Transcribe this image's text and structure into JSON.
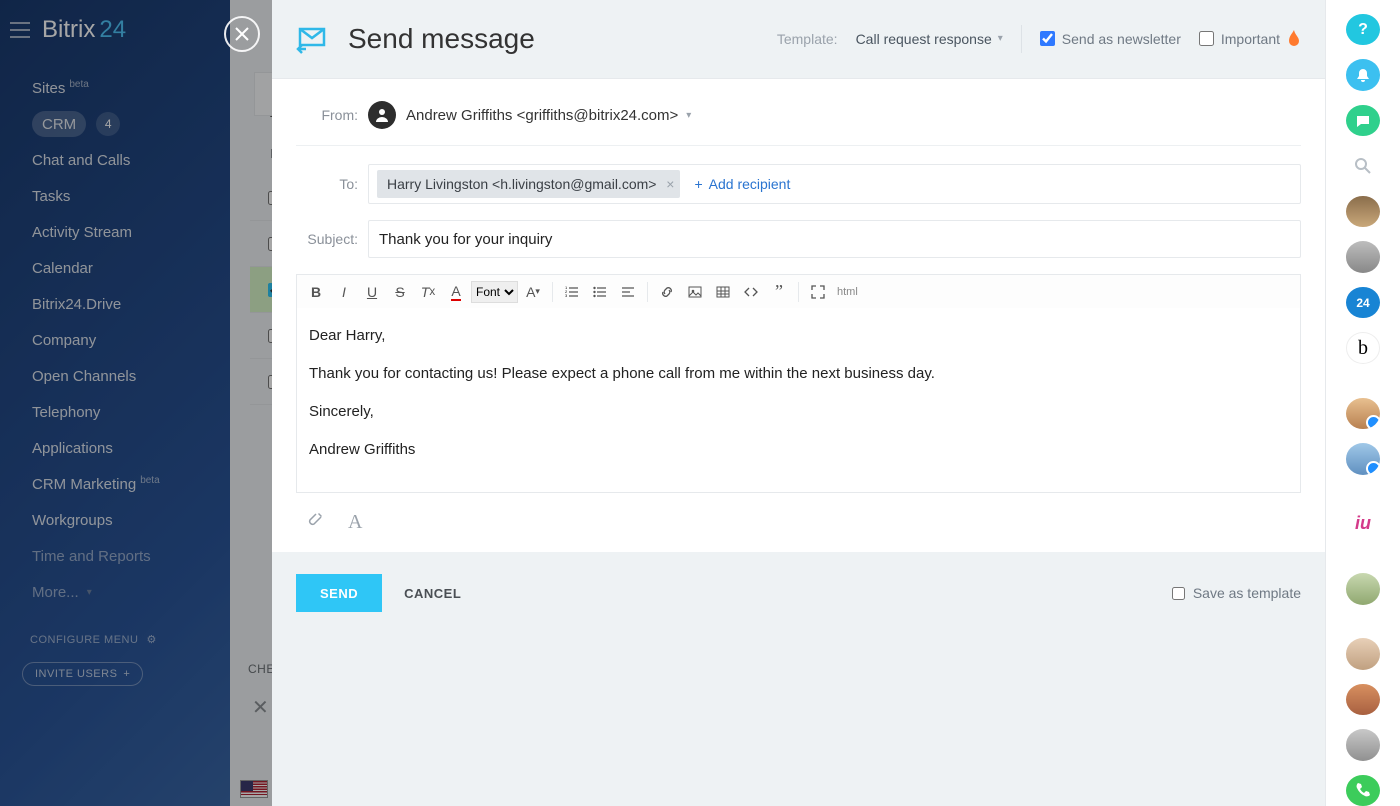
{
  "brand": {
    "part1": "Bitrix",
    "part2": "24"
  },
  "nav": {
    "sites": {
      "label": "Sites",
      "badge": "beta"
    },
    "crm": {
      "label": "CRM",
      "count": "4"
    },
    "chat": {
      "label": "Chat and Calls"
    },
    "tasks": {
      "label": "Tasks"
    },
    "activity": {
      "label": "Activity Stream"
    },
    "calendar": {
      "label": "Calendar"
    },
    "drive": {
      "label": "Bitrix24.Drive"
    },
    "company": {
      "label": "Company"
    },
    "open": {
      "label": "Open Channels"
    },
    "tel": {
      "label": "Telephony"
    },
    "apps": {
      "label": "Applications"
    },
    "crmmkt": {
      "label": "CRM Marketing",
      "badge": "beta"
    },
    "wg": {
      "label": "Workgroups"
    },
    "time": {
      "label": "Time and Reports"
    },
    "more": {
      "label": "More..."
    }
  },
  "configure": "CONFIGURE MENU",
  "invite": "INVITE USERS",
  "bg": {
    "tab": "St",
    "title": "Le",
    "sub": "Lead",
    "bottom": "CHE",
    "x": "✕  D"
  },
  "modal": {
    "title": "Send message",
    "template_label": "Template:",
    "template_value": "Call request response",
    "newsletter": "Send as newsletter",
    "important": "Important",
    "from_label": "From:",
    "from_value": "Andrew Griffiths <griffiths@bitrix24.com>",
    "to_label": "To:",
    "to_chip": "Harry Livingston <h.livingston@gmail.com>",
    "add_recipient": "Add recipient",
    "subject_label": "Subject:",
    "subject_value": "Thank you for your inquiry",
    "font_label": "Font",
    "html_label": "html",
    "body": {
      "p1": "Dear Harry,",
      "p2": "Thank you for contacting us! Please expect a phone call from me within the next business day.",
      "p3": "Sincerely,",
      "p4": "Andrew Griffiths"
    },
    "send": "SEND",
    "cancel": "CANCEL",
    "save_template": "Save as template"
  },
  "rail": {
    "help": "?",
    "b24": "24",
    "bx": "b",
    "iu": "iu"
  }
}
